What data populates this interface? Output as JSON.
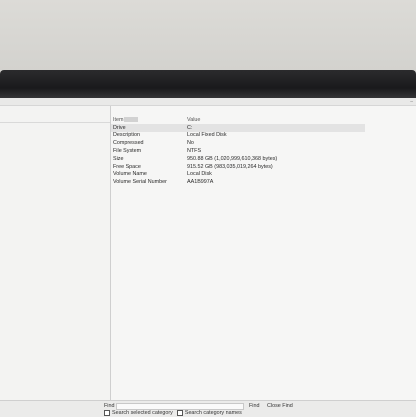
{
  "table": {
    "header": {
      "item": "Item",
      "value": "Value"
    },
    "rows": [
      {
        "item": "Drive",
        "value": "C:"
      },
      {
        "item": "Description",
        "value": "Local Fixed Disk"
      },
      {
        "item": "Compressed",
        "value": "No"
      },
      {
        "item": "File System",
        "value": "NTFS"
      },
      {
        "item": "Size",
        "value": "950.88 GB (1,020,999,610,368 bytes)"
      },
      {
        "item": "Free Space",
        "value": "915.52 GB (983,035,019,264 bytes)"
      },
      {
        "item": "Volume Name",
        "value": "Local Disk"
      },
      {
        "item": "Volume Serial Number",
        "value": "AA1B997A"
      }
    ]
  },
  "find_bar": {
    "label": "Find",
    "find_button": "Find",
    "close_button": "Close Find",
    "option_selected_category": "Search selected category",
    "option_category_names": "Search category names"
  },
  "colors": {
    "selected_row": "#e3e3e3",
    "bezel": "#1a1a1c"
  }
}
